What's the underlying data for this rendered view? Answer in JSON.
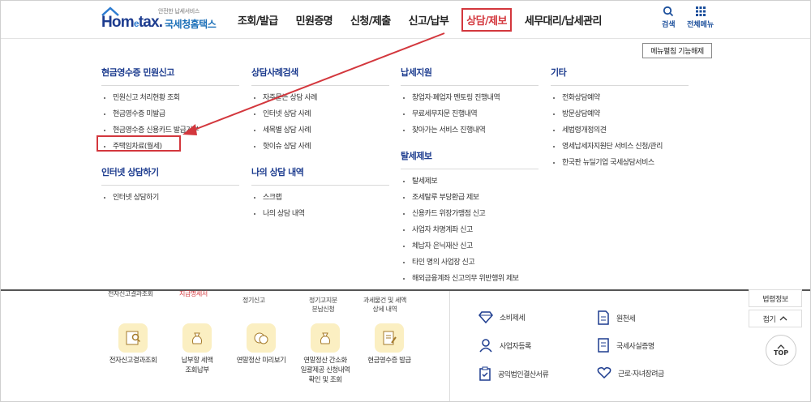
{
  "header": {
    "logo_top": "안전한 납세서비스",
    "logo_main": "Hom",
    "logo_e": "e",
    "logo_tax": "tax.",
    "logo_sub": "국세청홈택스",
    "nav": [
      "조회/발급",
      "민원증명",
      "신청/제출",
      "신고/납부",
      "상담/제보",
      "세무대리/납세관리"
    ],
    "active_nav": "상담/제보",
    "search_label": "검색",
    "allmenu_label": "전체메뉴"
  },
  "mega_menu": {
    "release_button": "메뉴펼침 기능해제",
    "columns": [
      {
        "sections": [
          {
            "title": "현금영수증 민원신고",
            "items": [
              "민원신고 처리현황 조회",
              "현금영수증 미발급",
              "현금영수증 신용카드 발급거부",
              "주택임차료(월세)"
            ]
          },
          {
            "title": "인터넷 상담하기",
            "items": [
              "인터넷 상담하기"
            ]
          }
        ]
      },
      {
        "sections": [
          {
            "title": "상담사례검색",
            "items": [
              "자주묻는 상담 사례",
              "인터넷 상담 사례",
              "세목별 상담 사례",
              "핫이슈 상담 사례"
            ]
          },
          {
            "title": "나의 상담 내역",
            "items": [
              "스크랩",
              "나의 상담 내역"
            ]
          }
        ]
      },
      {
        "sections": [
          {
            "title": "납세지원",
            "items": [
              "창업자·폐업자 멘토링 진행내역",
              "무료세무자문 진행내역",
              "찾아가는 서비스 진행내역"
            ]
          },
          {
            "title": "탈세제보",
            "items": [
              "탈세제보",
              "조세탈루 부당환급 제보",
              "신용카드 위장가맹점 신고",
              "사업자 차명계좌 신고",
              "체납자 은닉재산 신고",
              "타인 명의 사업장 신고",
              "해외금융계좌 신고의무 위반행위 제보"
            ]
          }
        ]
      },
      {
        "sections": [
          {
            "title": "기타",
            "items": [
              "전화상담예약",
              "방문상담예약",
              "세법령개정의견",
              "영세납세자지원단 서비스 신청/관리",
              "한국판 뉴딜기업 국세상담서비스"
            ]
          }
        ]
      }
    ],
    "highlighted_item": "주택임차료(월세)"
  },
  "lower": {
    "partial_texts": [
      "전자신고결과조회",
      "지급명세서",
      "정기신고",
      "정기고지분\n분납신청",
      "과세물건 및 세액\n상세 내역"
    ],
    "tiles": [
      "전자신고결과조회",
      "납부할 세액\n조회납부",
      "연말정산 미리보기",
      "연말정산 간소화\n일괄제공 신청내역\n확인 및 조회",
      "현금영수증 발급"
    ],
    "services": [
      "소비제세",
      "원천세",
      "사업자등록",
      "국세사실증명",
      "공익법인결산서류",
      "근로·자녀장려금"
    ]
  },
  "side": {
    "law_info": "법령정보",
    "collapse": "접기",
    "top": "TOP"
  },
  "colors": {
    "accent_red": "#d3373d",
    "brand_blue": "#1d3c8f"
  }
}
